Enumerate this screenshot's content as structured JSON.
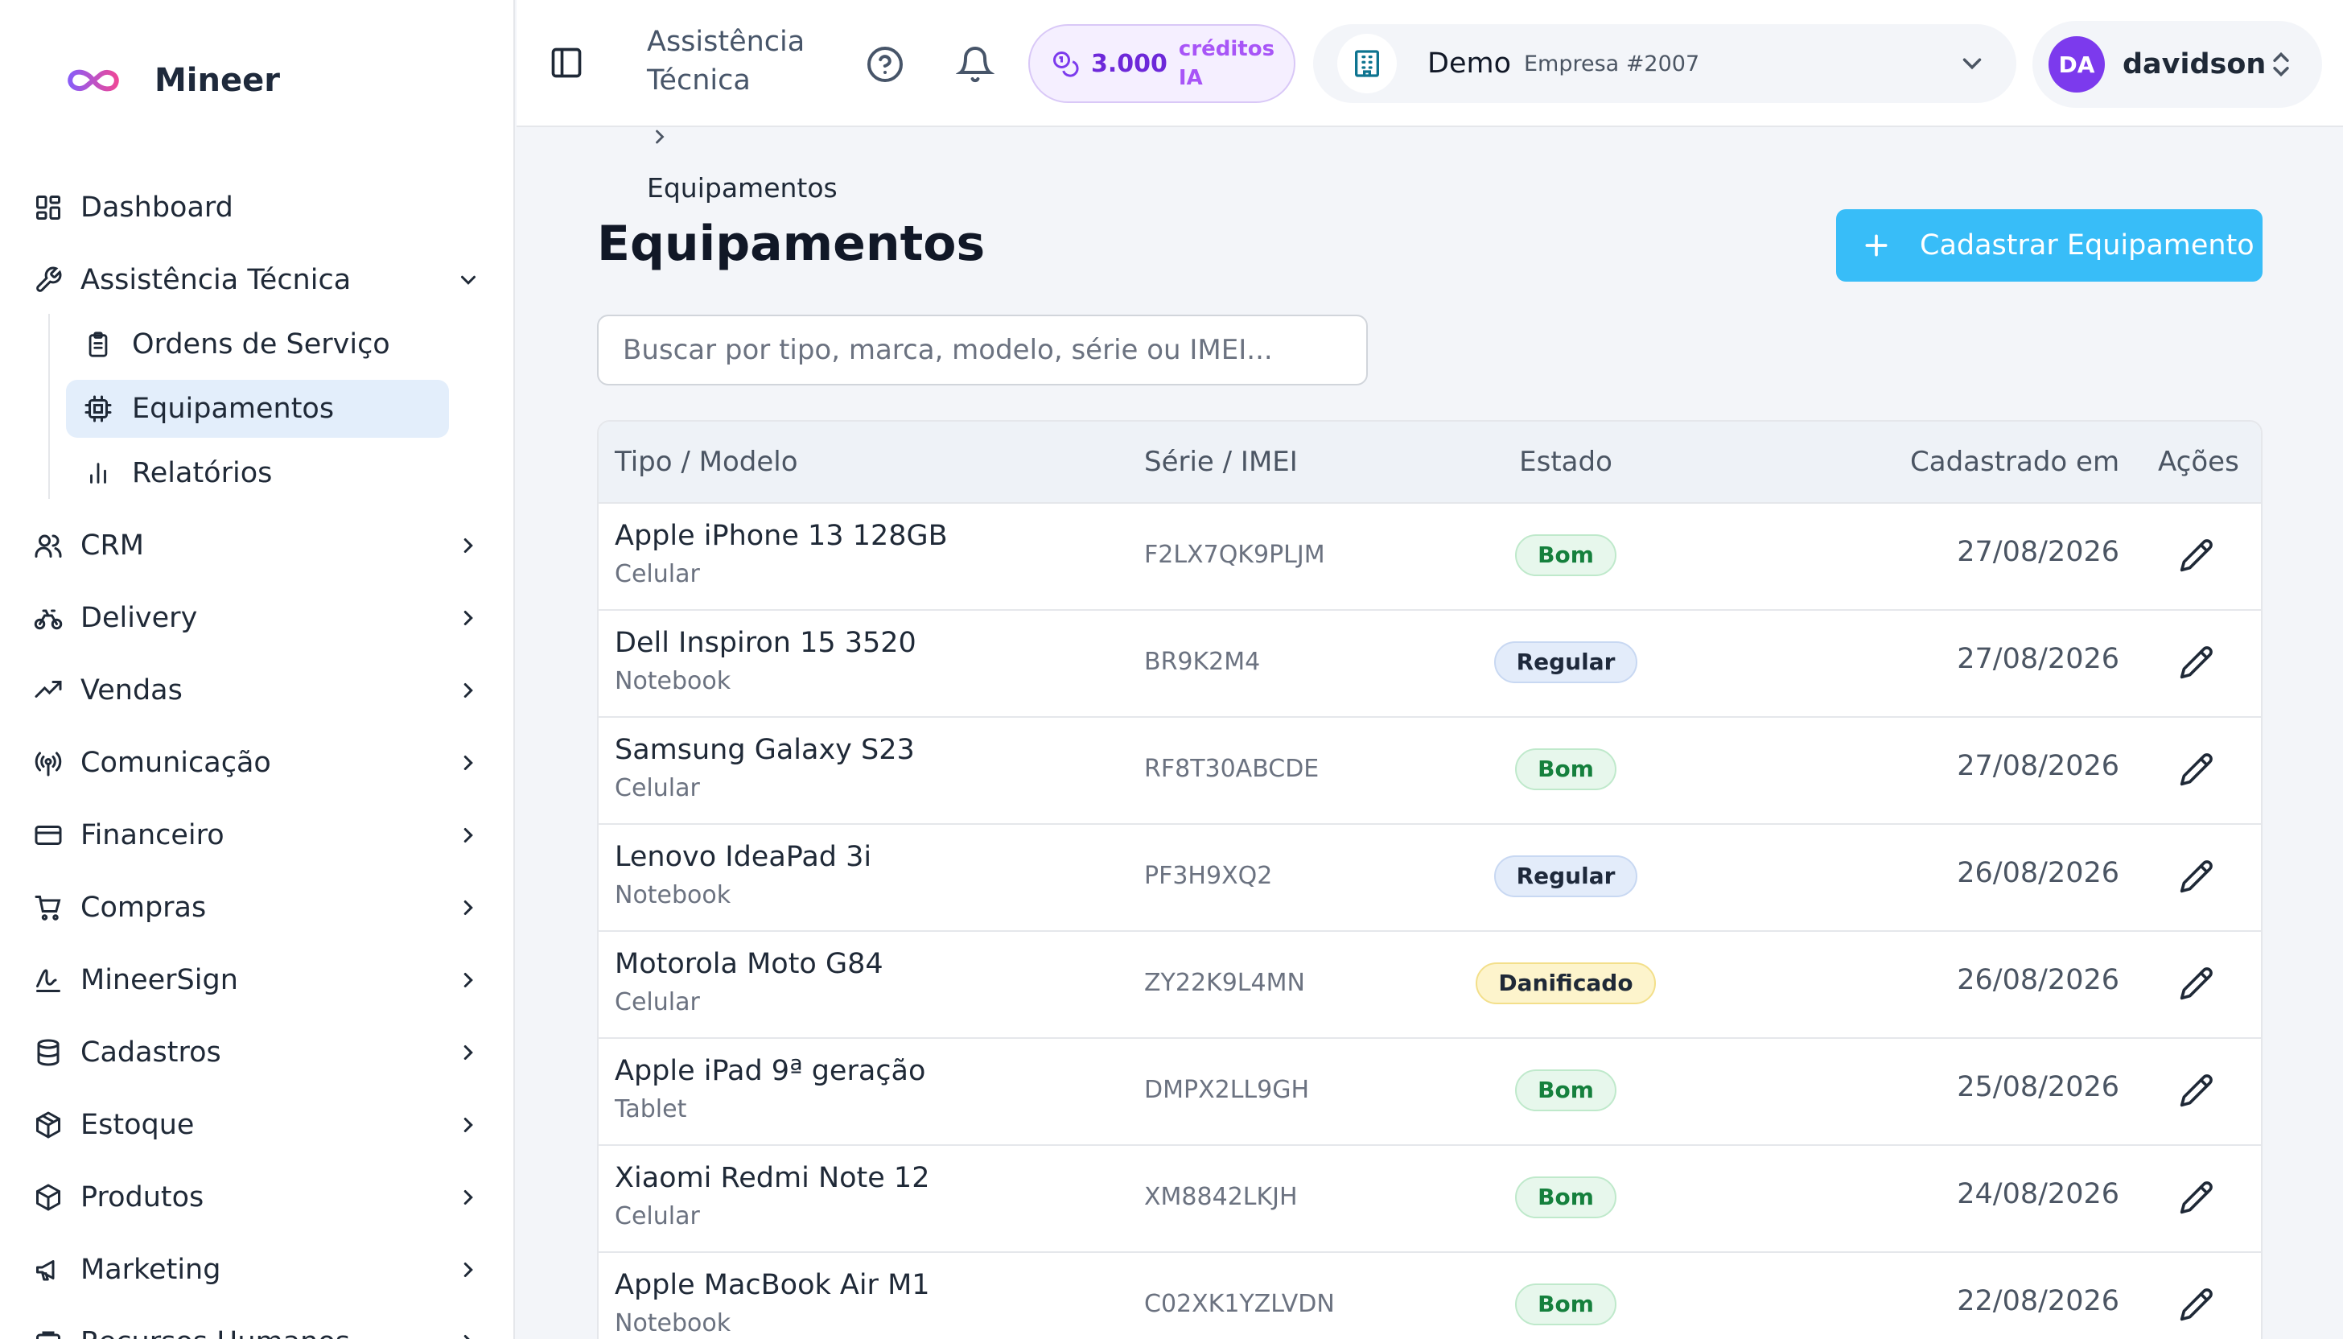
{
  "brand": {
    "name": "Mineer"
  },
  "sidebar": {
    "items": [
      {
        "label": "Dashboard",
        "icon": "dashboard-icon"
      },
      {
        "label": "Assistência Técnica",
        "icon": "wrench-icon",
        "expanded": true,
        "children": [
          {
            "label": "Ordens de Serviço",
            "icon": "clipboard-icon"
          },
          {
            "label": "Equipamentos",
            "icon": "cpu-icon",
            "active": true
          },
          {
            "label": "Relatórios",
            "icon": "bar-chart-icon"
          }
        ]
      },
      {
        "label": "CRM",
        "icon": "users-icon"
      },
      {
        "label": "Delivery",
        "icon": "bike-icon"
      },
      {
        "label": "Vendas",
        "icon": "trending-up-icon"
      },
      {
        "label": "Comunicação",
        "icon": "radio-icon"
      },
      {
        "label": "Financeiro",
        "icon": "credit-card-icon"
      },
      {
        "label": "Compras",
        "icon": "cart-icon"
      },
      {
        "label": "MineerSign",
        "icon": "signature-icon"
      },
      {
        "label": "Cadastros",
        "icon": "database-icon"
      },
      {
        "label": "Estoque",
        "icon": "package-icon"
      },
      {
        "label": "Produtos",
        "icon": "box-icon"
      },
      {
        "label": "Marketing",
        "icon": "megaphone-icon"
      },
      {
        "label": "Recursos Humanos",
        "icon": "people-icon"
      }
    ]
  },
  "header": {
    "module_title": "Assistência Técnica",
    "credits": {
      "amount": "3.000",
      "label": "créditos IA"
    },
    "company": {
      "name": "Demo",
      "id": "Empresa #2007"
    },
    "user": {
      "initials": "DA",
      "name": "davidson"
    }
  },
  "breadcrumb": {
    "current": "Equipamentos"
  },
  "page": {
    "title": "Equipamentos",
    "add_button": "Cadastrar Equipamento",
    "search_placeholder": "Buscar por tipo, marca, modelo, série ou IMEI..."
  },
  "colors": {
    "accent": "#38bdf8",
    "active_bg": "#e3eefb",
    "purple": "#7c3aed"
  },
  "table": {
    "columns": [
      "Tipo / Modelo",
      "Série / IMEI",
      "Estado",
      "Cadastrado em",
      "Ações"
    ],
    "rows": [
      {
        "model": "Apple iPhone 13 128GB",
        "type": "Celular",
        "serial": "F2LX7QK9PLJM",
        "status": "Bom",
        "status_kind": "bom",
        "date": "27/08/2026"
      },
      {
        "model": "Dell Inspiron 15 3520",
        "type": "Notebook",
        "serial": "BR9K2M4",
        "status": "Regular",
        "status_kind": "regular",
        "date": "27/08/2026"
      },
      {
        "model": "Samsung Galaxy S23",
        "type": "Celular",
        "serial": "RF8T30ABCDE",
        "status": "Bom",
        "status_kind": "bom",
        "date": "27/08/2026"
      },
      {
        "model": "Lenovo IdeaPad 3i",
        "type": "Notebook",
        "serial": "PF3H9XQ2",
        "status": "Regular",
        "status_kind": "regular",
        "date": "26/08/2026"
      },
      {
        "model": "Motorola Moto G84",
        "type": "Celular",
        "serial": "ZY22K9L4MN",
        "status": "Danificado",
        "status_kind": "danificado",
        "date": "26/08/2026"
      },
      {
        "model": "Apple iPad 9ª geração",
        "type": "Tablet",
        "serial": "DMPX2LL9GH",
        "status": "Bom",
        "status_kind": "bom",
        "date": "25/08/2026"
      },
      {
        "model": "Xiaomi Redmi Note 12",
        "type": "Celular",
        "serial": "XM8842LKJH",
        "status": "Bom",
        "status_kind": "bom",
        "date": "24/08/2026"
      },
      {
        "model": "Apple MacBook Air M1",
        "type": "Notebook",
        "serial": "C02XK1YZLVDN",
        "status": "Bom",
        "status_kind": "bom",
        "date": "22/08/2026"
      }
    ]
  }
}
